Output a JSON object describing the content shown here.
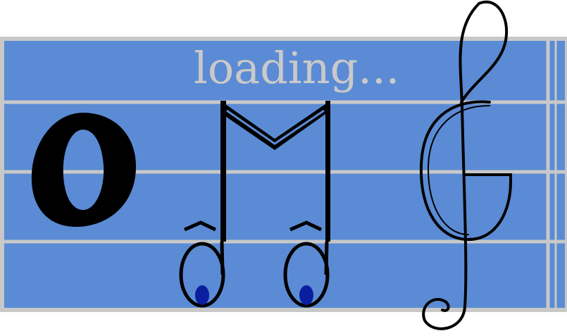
{
  "loading": {
    "text": "loading..."
  },
  "colors": {
    "staff_background": "#5b8bd4",
    "staff_border": "#c8c8c8",
    "ink": "#000000",
    "pupil": "#0a1fa0",
    "page": "#ffffff"
  },
  "icons": {
    "whole_note": "letter-o-whole-note-icon",
    "beamed_notes": "beamed-eighth-notes-m-icon",
    "treble_clef": "treble-clef-g-icon"
  }
}
